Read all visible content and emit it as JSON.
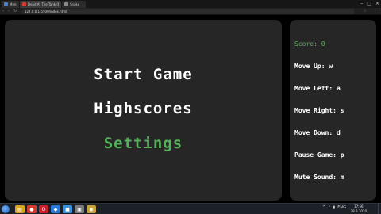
{
  "browser": {
    "tabs": [
      {
        "title": "Menu",
        "fav_color": "#4a7fd4",
        "active": false
      },
      {
        "title": "Dead At The Tank (Remast...",
        "fav_color": "#d63a2a",
        "active": true
      },
      {
        "title": "Snake",
        "fav_color": "#888888",
        "active": false
      }
    ],
    "window_controls": [
      "–",
      "□",
      "×"
    ],
    "url": "127.0.0.1:5500/index.html",
    "nav": {
      "back": "‹",
      "forward": "›",
      "reload": "↻"
    },
    "star": "☆",
    "menu": "⋮"
  },
  "game": {
    "menu": {
      "start": "Start Game",
      "highscores": "Highscores",
      "settings": "Settings"
    },
    "side": {
      "score": "Score: 0",
      "move_up": "Move Up: w",
      "move_left": "Move Left: a",
      "move_right": "Move Right: s",
      "move_down": "Move Down: d",
      "pause": "Pause Game: p",
      "mute": "Mute Sound: m"
    },
    "colors": {
      "panel": "#262626",
      "text": "#ffffff",
      "accent": "#56b05b"
    }
  },
  "taskbar": {
    "apps": [
      {
        "name": "file-explorer-icon",
        "glyph": "▤",
        "color": "#d9a520"
      },
      {
        "name": "chrome-icon",
        "glyph": "●",
        "color": "#d33b2c"
      },
      {
        "name": "opera-icon",
        "glyph": "O",
        "color": "#cc1f2f"
      },
      {
        "name": "vscode-icon",
        "glyph": "◆",
        "color": "#2b7bd6"
      },
      {
        "name": "app-icon",
        "glyph": "■",
        "color": "#3a8fd9"
      },
      {
        "name": "photos-icon",
        "glyph": "▣",
        "color": "#7a7a7a"
      },
      {
        "name": "chrome-2-icon",
        "glyph": "◉",
        "color": "#c9a23a"
      }
    ],
    "tray": [
      "^",
      "♪",
      "▮",
      "ENG"
    ],
    "clock": {
      "time": "17:56",
      "date": "29.3.2020"
    }
  }
}
